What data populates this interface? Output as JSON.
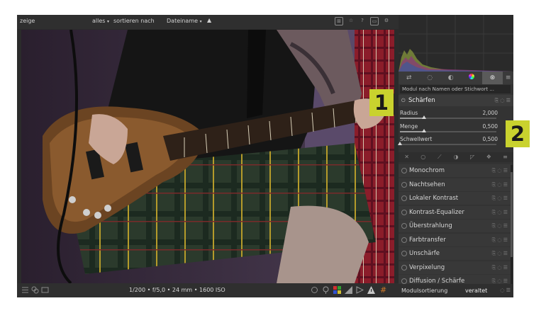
{
  "topbar": {
    "show_label": "zeige",
    "filter_value": "alles",
    "sort_label": "sortieren nach",
    "sort_value": "Dateiname",
    "sort_dir": "▲"
  },
  "bottombar": {
    "exif": "1/200 • f/5,0 • 24 mm • 1600 ISO"
  },
  "panel": {
    "search_placeholder": "Modul nach Namen oder Stichwort ...",
    "tab_icons": [
      "presets-icon",
      "power-icon",
      "star-icon",
      "color-icon",
      "tone-icon"
    ],
    "sharpen": {
      "title": "Schärfen",
      "params": [
        {
          "label": "Radius",
          "value": "2,000",
          "fraction": 0.25
        },
        {
          "label": "Menge",
          "value": "0,500",
          "fraction": 0.25
        },
        {
          "label": "Schwellwert",
          "value": "0,500",
          "fraction": 0.0
        }
      ]
    },
    "modules": [
      "Monochrom",
      "Nachtsehen",
      "Lokaler Kontrast",
      "Kontrast-Equalizer",
      "Überstrahlung",
      "Farbtransfer",
      "Unschärfe",
      "Verpixelung",
      "Diffusion / Schärfe"
    ],
    "footer_label": "Modulsortierung",
    "footer_value": "veraltet"
  },
  "callouts": [
    "1",
    "2"
  ],
  "colors": {
    "accent_badge": "#c9d22e",
    "background": "#2b2b2b"
  }
}
